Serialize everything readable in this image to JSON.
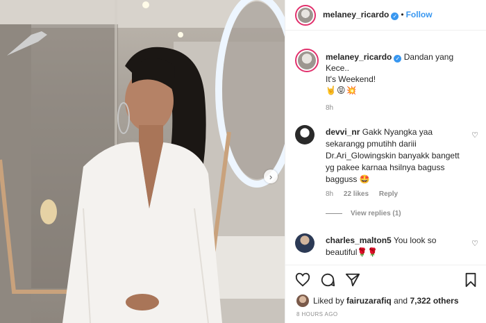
{
  "header": {
    "username": "melaney_ricardo",
    "separator": "•",
    "follow_label": "Follow"
  },
  "caption": {
    "username": "melaney_ricardo",
    "line1": "Dandan yang Kece..",
    "line2": "It's Weekend!",
    "emojis": "🤘😝💥",
    "time": "8h"
  },
  "comments": [
    {
      "username": "devvi_nr",
      "text": "Gakk Nyangka yaa sekarangg pmutihh dariii Dr.Ari_Glowingskin banyakk bangett yg pakee karnaa hsilnya baguss bagguss 🤩",
      "time": "8h",
      "likes": "22 likes",
      "reply_label": "Reply",
      "view_replies": "View replies (1)"
    },
    {
      "username": "charles_malton5",
      "text": "You look so beautiful🌹🌹"
    }
  ],
  "likes": {
    "prefix": "Liked by",
    "user": "fairuzarafiq",
    "connector": "and",
    "others": "7,322 others"
  },
  "timestamp": "8 HOURS AGO",
  "colors": {
    "link_blue": "#3897f0",
    "story_ring": "#e1306c",
    "muted_text": "#8e8e8e"
  },
  "icons": [
    "verified-icon",
    "heart-icon",
    "comment-icon",
    "share-icon",
    "bookmark-icon",
    "chevron-right-icon"
  ]
}
